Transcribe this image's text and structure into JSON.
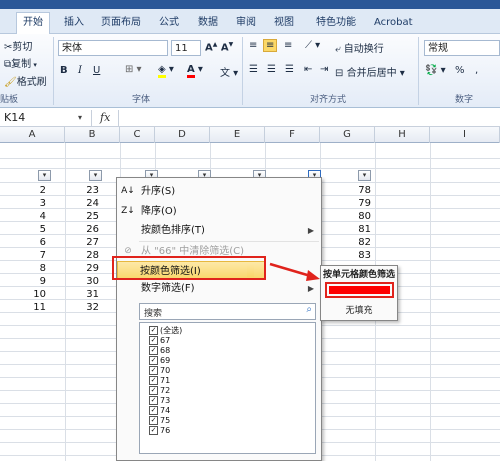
{
  "ribbon": {
    "tabs": [
      "开始",
      "插入",
      "页面布局",
      "公式",
      "数据",
      "审阅",
      "视图",
      "特色功能",
      "Acrobat"
    ],
    "active_tab": "开始",
    "clipboard": {
      "cut": "剪切",
      "copy": "复制",
      "format_painter": "格式刷",
      "group": "贴板"
    },
    "font": {
      "name": "宋体",
      "size": "11",
      "group": "字体",
      "bold": "B",
      "italic": "I",
      "underline": "U"
    },
    "alignment": {
      "wrap": "自动换行",
      "merge": "合并后居中",
      "group": "对齐方式"
    },
    "number": {
      "format": "常规",
      "percent": "%",
      "group": "数字"
    }
  },
  "formula_bar": {
    "name_box": "K14",
    "fx": "fx"
  },
  "columns": [
    "A",
    "B",
    "C",
    "D",
    "E",
    "F",
    "G",
    "H",
    "I"
  ],
  "rows": {
    "a": [
      "2",
      "3",
      "4",
      "5",
      "6",
      "7",
      "8",
      "9",
      "10",
      "11"
    ],
    "b": [
      "23",
      "24",
      "25",
      "26",
      "27",
      "28",
      "29",
      "30",
      "31",
      "32"
    ],
    "g": [
      "78",
      "79",
      "80",
      "81",
      "82",
      "83"
    ]
  },
  "menu": {
    "sort_asc": "升序(S)",
    "sort_desc": "降序(O)",
    "sort_color": "按颜色排序(T)",
    "clear_filter": "从 \"66\" 中清除筛选(C)",
    "filter_color": "按颜色筛选(I)",
    "number_filter": "数字筛选(F)",
    "search_placeholder": "搜索",
    "items": [
      "(全选)",
      "67",
      "68",
      "69",
      "70",
      "71",
      "72",
      "73",
      "74",
      "75",
      "76"
    ]
  },
  "submenu": {
    "title": "按单元格颜色筛选",
    "no_fill": "无填充",
    "swatch_color": "#ff0000"
  },
  "colors": {
    "highlight": "#f9d66a",
    "annotation": "#e0231c"
  }
}
